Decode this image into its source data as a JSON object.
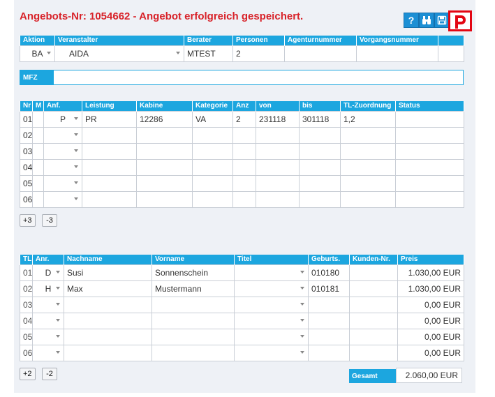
{
  "header": {
    "title": "Angebots-Nr: 1054662 - Angebot erfolgreich gespeichert.",
    "help_icon_glyph": "?",
    "icons": [
      "help-icon",
      "binoculars-icon",
      "save-icon",
      "p-logo-icon"
    ],
    "brand_color": "#1ca6df",
    "accent_color": "#e30613"
  },
  "booking": {
    "columns": [
      "Aktion",
      "Veranstalter",
      "Berater",
      "Personen",
      "Agenturnummer",
      "Vorgangsnummer"
    ],
    "aktion": "BA",
    "veranstalter": "AIDA",
    "berater": "MTEST",
    "personen": "2",
    "agenturnummer": "",
    "vorgangsnummer": ""
  },
  "mfz": {
    "label": "MFZ",
    "value": ""
  },
  "services": {
    "columns": [
      "Nr",
      "M",
      "Anf.",
      "Leistung",
      "Kabine",
      "Kategorie",
      "Anz",
      "von",
      "bis",
      "TL-Zuordnung",
      "Status"
    ],
    "rows": [
      {
        "nr": "01",
        "m": "",
        "anf": "P",
        "leistung": "PR",
        "kabine": "12286",
        "kategorie": "VA",
        "anz": "2",
        "von": "231118",
        "bis": "301118",
        "tl": "1,2",
        "status": ""
      },
      {
        "nr": "02",
        "m": "",
        "anf": "",
        "leistung": "",
        "kabine": "",
        "kategorie": "",
        "anz": "",
        "von": "",
        "bis": "",
        "tl": "",
        "status": ""
      },
      {
        "nr": "03",
        "m": "",
        "anf": "",
        "leistung": "",
        "kabine": "",
        "kategorie": "",
        "anz": "",
        "von": "",
        "bis": "",
        "tl": "",
        "status": ""
      },
      {
        "nr": "04",
        "m": "",
        "anf": "",
        "leistung": "",
        "kabine": "",
        "kategorie": "",
        "anz": "",
        "von": "",
        "bis": "",
        "tl": "",
        "status": ""
      },
      {
        "nr": "05",
        "m": "",
        "anf": "",
        "leistung": "",
        "kabine": "",
        "kategorie": "",
        "anz": "",
        "von": "",
        "bis": "",
        "tl": "",
        "status": ""
      },
      {
        "nr": "06",
        "m": "",
        "anf": "",
        "leistung": "",
        "kabine": "",
        "kategorie": "",
        "anz": "",
        "von": "",
        "bis": "",
        "tl": "",
        "status": ""
      }
    ],
    "add_label": "+3",
    "remove_label": "-3"
  },
  "travellers": {
    "columns": [
      "TL",
      "Anr.",
      "Nachname",
      "Vorname",
      "Titel",
      "Geburts.",
      "Kunden-Nr.",
      "Preis"
    ],
    "rows": [
      {
        "tl": "01",
        "anr": "D",
        "nachname": "Susi",
        "vorname": "Sonnenschein",
        "titel": "",
        "geburts": "010180",
        "kunden": "",
        "preis": "1.030,00 EUR"
      },
      {
        "tl": "02",
        "anr": "H",
        "nachname": "Max",
        "vorname": "Mustermann",
        "titel": "",
        "geburts": "010181",
        "kunden": "",
        "preis": "1.030,00 EUR"
      },
      {
        "tl": "03",
        "anr": "",
        "nachname": "",
        "vorname": "",
        "titel": "",
        "geburts": "",
        "kunden": "",
        "preis": "0,00 EUR"
      },
      {
        "tl": "04",
        "anr": "",
        "nachname": "",
        "vorname": "",
        "titel": "",
        "geburts": "",
        "kunden": "",
        "preis": "0,00 EUR"
      },
      {
        "tl": "05",
        "anr": "",
        "nachname": "",
        "vorname": "",
        "titel": "",
        "geburts": "",
        "kunden": "",
        "preis": "0,00 EUR"
      },
      {
        "tl": "06",
        "anr": "",
        "nachname": "",
        "vorname": "",
        "titel": "",
        "geburts": "",
        "kunden": "",
        "preis": "0,00 EUR"
      }
    ],
    "add_label": "+2",
    "remove_label": "-2",
    "total_label": "Gesamt",
    "total_value": "2.060,00 EUR"
  }
}
